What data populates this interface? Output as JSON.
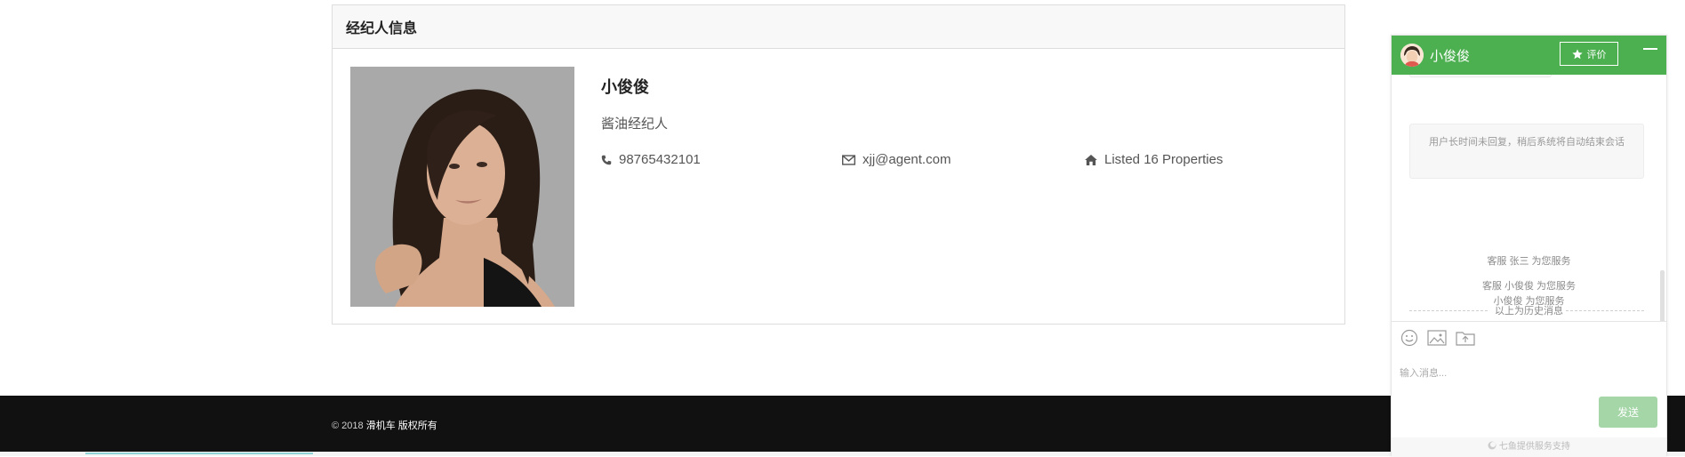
{
  "agent_panel": {
    "title": "经纪人信息",
    "name": "小俊俊",
    "role": "酱油经纪人",
    "phone": "98765432101",
    "email": "xjj@agent.com",
    "listings": "Listed 16 Properties",
    "icons": {
      "phone": "phone-icon",
      "email": "envelope-icon",
      "listings": "home-icon"
    }
  },
  "footer": {
    "copyright_prefix": "© 2018 ",
    "copyright_brand": "滑机车 版权所有"
  },
  "chat": {
    "title": "小俊俊",
    "rate_label": "评价",
    "notice": "用户长时间未回复，稍后系统将自动结束会话",
    "messages": [
      "客服 张三 为您服务",
      "客服 小俊俊 为您服务",
      "以上为历史消息",
      "小俊俊 为您服务"
    ],
    "input_placeholder": "输入消息...",
    "send_label": "发送",
    "powered_by": "七鱼提供服务支持",
    "colors": {
      "header": "#4caf50",
      "send": "#a5d6a7"
    }
  }
}
